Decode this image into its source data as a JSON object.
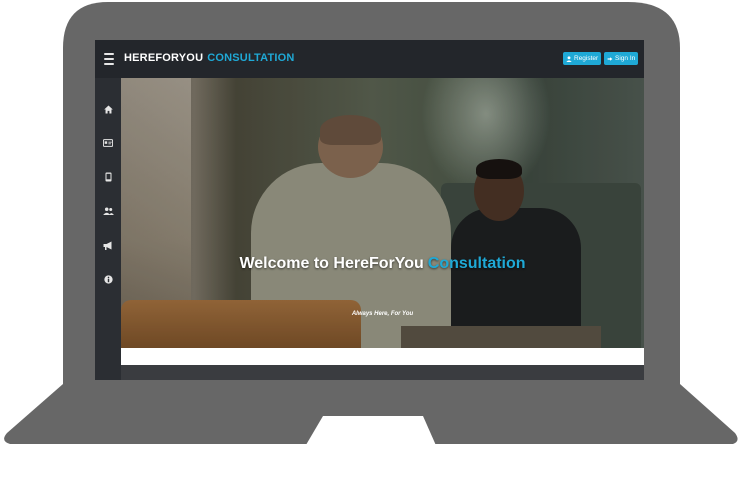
{
  "app": {
    "brand_primary": "HEREFORYOU",
    "brand_secondary": "CONSULTATION",
    "menu_icon": "hamburger-icon"
  },
  "header": {
    "register_label": "Register",
    "signin_label": "Sign In",
    "register_icon": "user-icon",
    "signin_icon": "sign-in-icon"
  },
  "sidebar": {
    "items": [
      {
        "icon": "home-icon"
      },
      {
        "icon": "id-card-icon"
      },
      {
        "icon": "mobile-icon"
      },
      {
        "icon": "users-icon"
      },
      {
        "icon": "bullhorn-icon"
      },
      {
        "icon": "info-icon"
      }
    ]
  },
  "hero": {
    "title_prefix": "Welcome to HereForYou",
    "title_accent": "Consultation",
    "subtitle": "Always Here, For You"
  },
  "colors": {
    "accent": "#1fa9d6",
    "topbar": "#23262b",
    "sidebar": "#2b2e33",
    "laptop_frame": "#676767"
  }
}
